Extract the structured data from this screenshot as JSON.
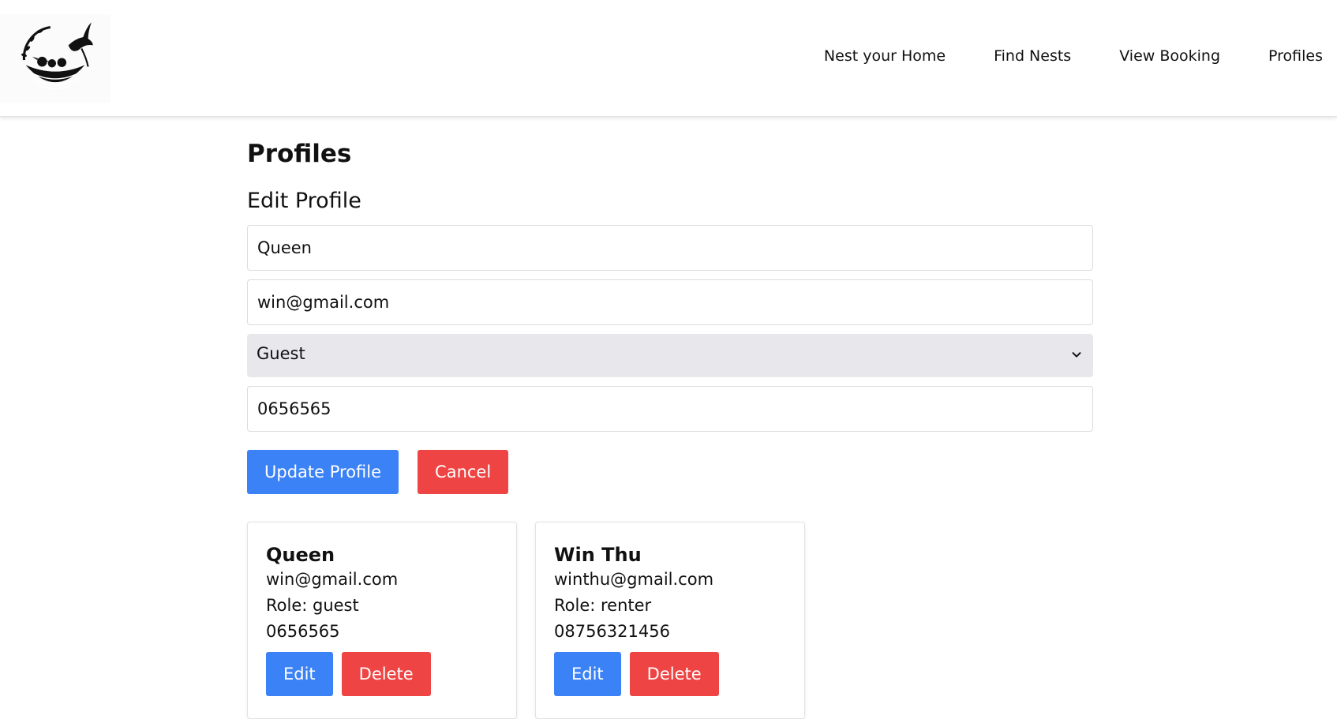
{
  "nav": {
    "items": [
      {
        "label": "Nest your Home"
      },
      {
        "label": "Find Nests"
      },
      {
        "label": "View Booking"
      },
      {
        "label": "Profiles"
      }
    ]
  },
  "page": {
    "title": "Profiles",
    "form_title": "Edit Profile"
  },
  "form": {
    "name_value": "Queen",
    "email_value": "win@gmail.com",
    "role_value": "Guest",
    "phone_value": "0656565",
    "update_label": "Update Profile",
    "cancel_label": "Cancel"
  },
  "profiles": [
    {
      "name": "Queen",
      "email": "win@gmail.com",
      "role": "Role: guest",
      "phone": "0656565",
      "edit_label": "Edit",
      "delete_label": "Delete"
    },
    {
      "name": "Win Thu",
      "email": "winthu@gmail.com",
      "role": "Role: renter",
      "phone": "08756321456",
      "edit_label": "Edit",
      "delete_label": "Delete"
    }
  ],
  "icons": {
    "logo": "bird-nest-logo-icon",
    "select": "chevron-down-icon"
  },
  "colors": {
    "primary": "#3b82f6",
    "danger": "#ef4444",
    "select_bg": "#e8e8ec"
  }
}
